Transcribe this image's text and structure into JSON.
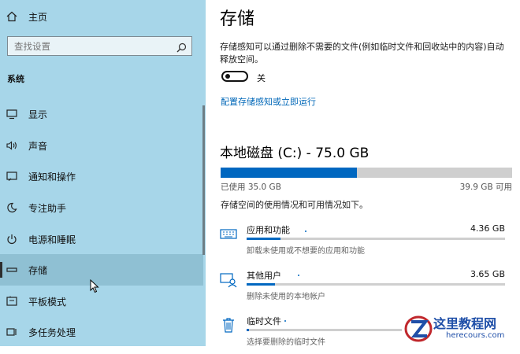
{
  "sidebar": {
    "home_label": "主页",
    "search_placeholder": "查找设置",
    "group_title": "系统",
    "items": [
      {
        "label": "显示",
        "icon": "monitor-icon"
      },
      {
        "label": "声音",
        "icon": "speaker-icon"
      },
      {
        "label": "通知和操作",
        "icon": "notification-icon"
      },
      {
        "label": "专注助手",
        "icon": "moon-icon"
      },
      {
        "label": "电源和睡眠",
        "icon": "power-icon"
      },
      {
        "label": "存储",
        "icon": "storage-drive-icon",
        "selected": true
      },
      {
        "label": "平板模式",
        "icon": "tablet-icon"
      },
      {
        "label": "多任务处理",
        "icon": "multitask-icon"
      }
    ]
  },
  "main": {
    "title": "存储",
    "storage_sense_desc": "存储感知可以通过删除不需要的文件(例如临时文件和回收站中的内容)自动释放空间。",
    "toggle": {
      "state": "off",
      "label": "关"
    },
    "configure_link": "配置存储感知或立即运行",
    "disk": {
      "title": "本地磁盘 (C:) - 75.0 GB",
      "used_label": "已使用 35.0 GB",
      "available_label": "39.9 GB 可用",
      "used_fraction": 0.467
    },
    "usage_desc": "存储空间的使用情况和可用情况如下。",
    "categories": [
      {
        "name": "应用和功能",
        "size": "4.36 GB",
        "sub": "卸载未使用或不想要的应用和功能",
        "icon": "keyboard-apps-icon",
        "fraction": 0.13
      },
      {
        "name": "其他用户",
        "size": "3.65 GB",
        "sub": "删除未使用的本地帐户",
        "icon": "other-user-icon",
        "fraction": 0.11
      },
      {
        "name": "临时文件",
        "size": "",
        "sub": "选择要删除的临时文件",
        "icon": "trash-icon",
        "fraction": 0.01
      }
    ]
  },
  "watermark": {
    "text": "这里教程网",
    "url": "herecours.com"
  },
  "colors": {
    "sidebar": "#a7d6e9",
    "accent": "#0067c0",
    "link": "#0067b8"
  }
}
